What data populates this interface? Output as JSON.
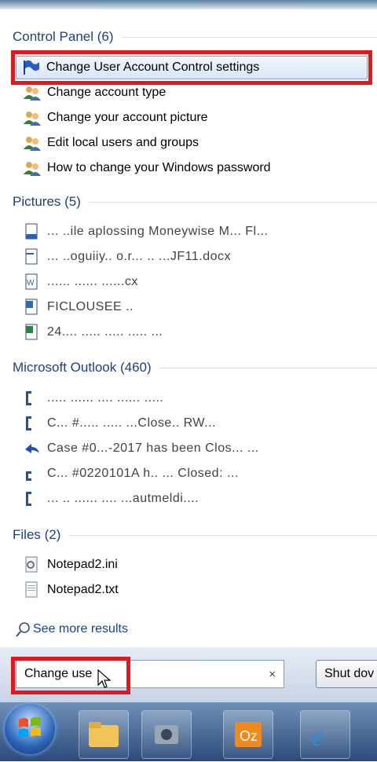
{
  "control_panel": {
    "header": "Control Panel (6)",
    "items": [
      "Change User Account Control settings",
      "Change account type",
      "Change your account picture",
      "Edit local users and groups",
      "How to change your Windows password"
    ]
  },
  "pictures": {
    "header": "Pictures (5)",
    "items": [
      "... ..ile aplossing Moneywise M... Fl...",
      "... ..oguiiy.. o.r... .. ...JF11.docx",
      "...... ...... ......cx",
      "FICLOUSEE ..",
      "24.... ..... ..... ..... ..."
    ]
  },
  "outlook": {
    "header": "Microsoft Outlook (460)",
    "items": [
      ".....   ......  ....   ......  .....",
      "C... #.....  .....  ...Close.. RW...",
      "Case #0...-2017 has been Clos... ...",
      "C... #0220101A h.. ... Closed: ...",
      "... .. ...... ....  ...autmeldi...."
    ]
  },
  "files": {
    "header": "Files (2)",
    "items": [
      "Notepad2.ini",
      "Notepad2.txt"
    ]
  },
  "see_more": "See more results",
  "search": {
    "value": "Change use",
    "clear": "×"
  },
  "shutdown_label": "Shut dov",
  "colors": {
    "highlight": "#e2181f",
    "group_title": "#1e3e8c",
    "taskbar": "#2b4b7a"
  }
}
